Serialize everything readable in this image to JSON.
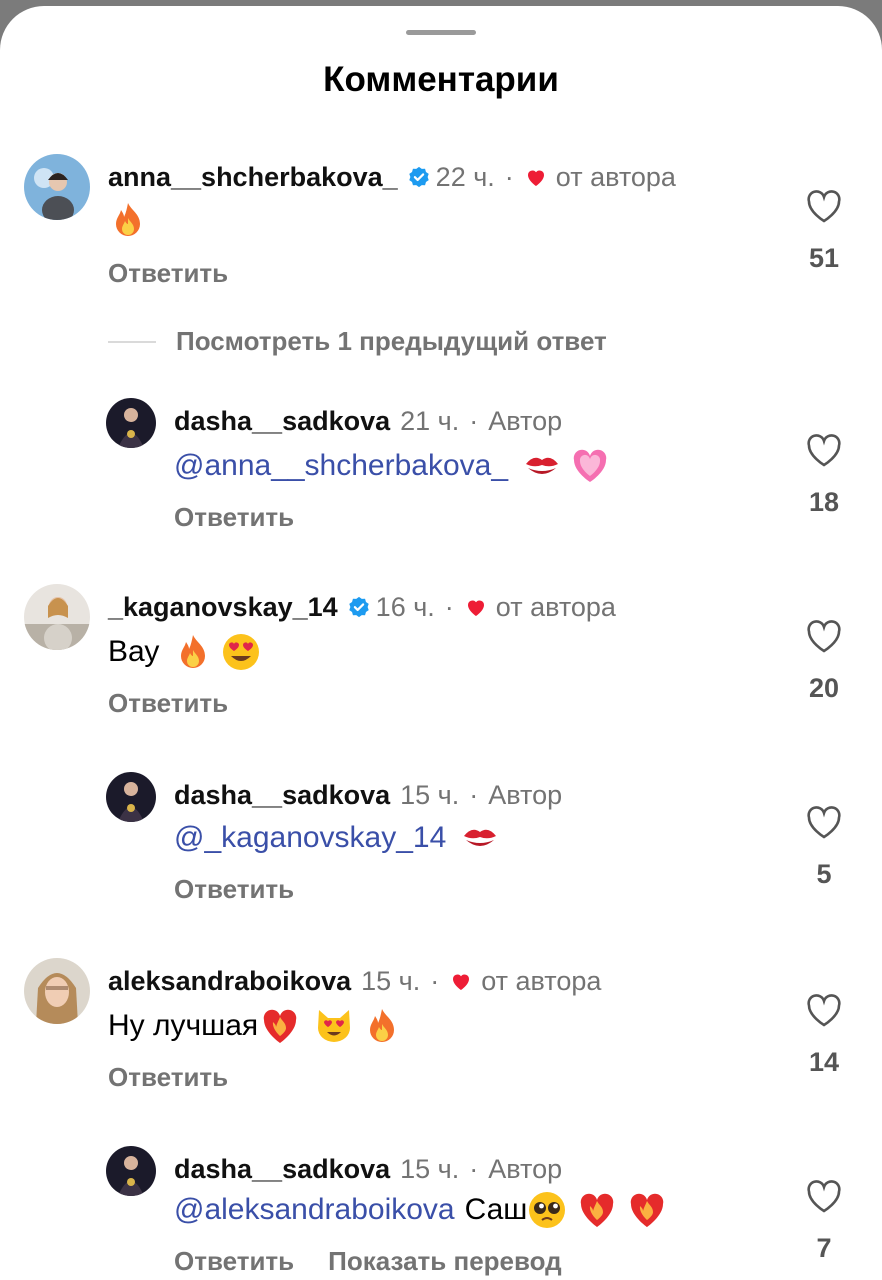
{
  "sheet": {
    "title": "Комментарии"
  },
  "comments": [
    {
      "username": "anna__shcherbakova_",
      "verified": true,
      "time": "22 ч.",
      "sep": "·",
      "author_like": "от автора",
      "text": "",
      "emojis": [
        "fire"
      ],
      "reply_label": "Ответить",
      "likes": "51"
    },
    {
      "view_more": "Посмотреть 1 предыдущий ответ"
    },
    {
      "username": "dasha__sadkova",
      "time": "21 ч.",
      "sep": "·",
      "author_badge": "Автор",
      "mention": "@anna__shcherbakova_",
      "text": "",
      "emojis": [
        "kiss-mark",
        "sparkling-heart"
      ],
      "reply_label": "Ответить",
      "likes": "18"
    },
    {
      "username": "_kaganovskay_14",
      "verified": true,
      "time": "16 ч.",
      "sep": "·",
      "author_like": "от автора",
      "text": "Вау",
      "emojis": [
        "fire",
        "heart-eyes"
      ],
      "reply_label": "Ответить",
      "likes": "20"
    },
    {
      "username": "dasha__sadkova",
      "time": "15 ч.",
      "sep": "·",
      "author_badge": "Автор",
      "mention": "@_kaganovskay_14",
      "text": "",
      "emojis": [
        "kiss-mark"
      ],
      "reply_label": "Ответить",
      "likes": "5"
    },
    {
      "username": "aleksandraboikova",
      "time": "15 ч.",
      "sep": "·",
      "author_like": "от автора",
      "text": "Ну лучшая",
      "emojis": [
        "heart-on-fire",
        "heart-eyes-cat",
        "fire"
      ],
      "reply_label": "Ответить",
      "likes": "14"
    },
    {
      "username": "dasha__sadkova",
      "time": "15 ч.",
      "sep": "·",
      "author_badge": "Автор",
      "mention": "@aleksandraboikova",
      "text": "Саш",
      "emojis": [
        "pleading-face",
        "heart-on-fire",
        "heart-on-fire"
      ],
      "reply_label": "Ответить",
      "translate_label": "Показать перевод",
      "likes": "7"
    }
  ],
  "colors": {
    "accent_mention": "#3a4fa8",
    "verified": "#1d9bf0",
    "heart_red": "#ee1d36",
    "meta_gray": "#737373"
  }
}
